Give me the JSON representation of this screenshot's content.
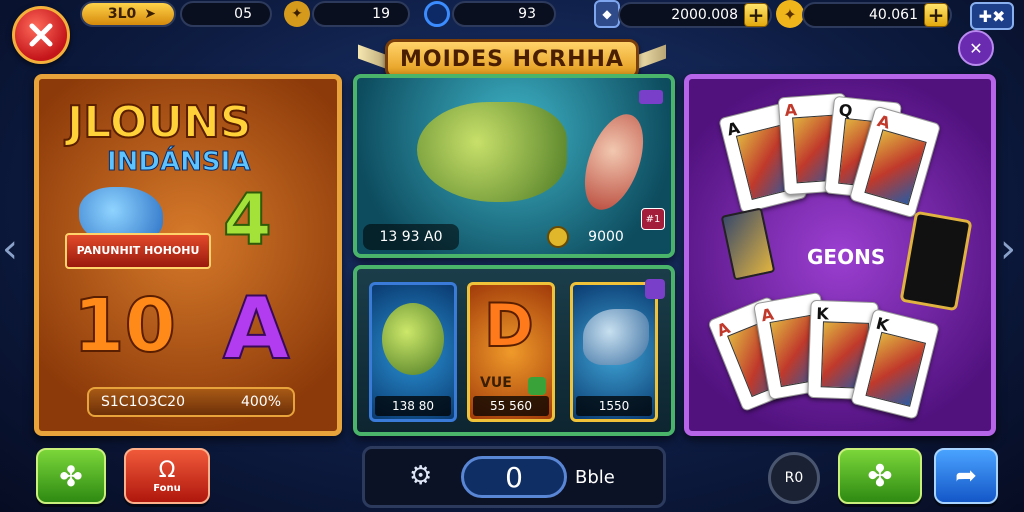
{
  "header": {
    "stat1": "3L0",
    "stat2": "05",
    "stat3": "19",
    "stat4": "93",
    "currency1": "2000.008",
    "currency2": "40.061"
  },
  "title": "MOIDES HCRHHA",
  "panels": {
    "left": {
      "title_line1": "JLOUNS",
      "title_line2": "INDÁNSIA",
      "ribbon": "PANUNHIT HOHOHU",
      "number": "10",
      "small_number": "4",
      "letter": "A",
      "footer_left": "S1C1O3C20",
      "footer_right": "400%"
    },
    "fish": {
      "left_value": "13 93 A0",
      "right_value": "9000",
      "badge": "#1"
    },
    "slots": [
      {
        "label": "138 80"
      },
      {
        "title": "VUE",
        "label": "55 560"
      },
      {
        "label": "1550"
      }
    ],
    "cards": {
      "center_text": "GEONS",
      "top_cards": [
        "A",
        "A",
        "Q",
        "A"
      ],
      "bottom_cards": [
        "A",
        "A",
        "K",
        "K"
      ]
    }
  },
  "bottom": {
    "counter": "0",
    "text": "Bble",
    "round_label": "R0",
    "red_label": "Fonu"
  },
  "colors": {
    "accent_gold": "#e8a33b",
    "green": "#4ab56a",
    "purple": "#b765e8",
    "red_button": "#c4151b"
  }
}
